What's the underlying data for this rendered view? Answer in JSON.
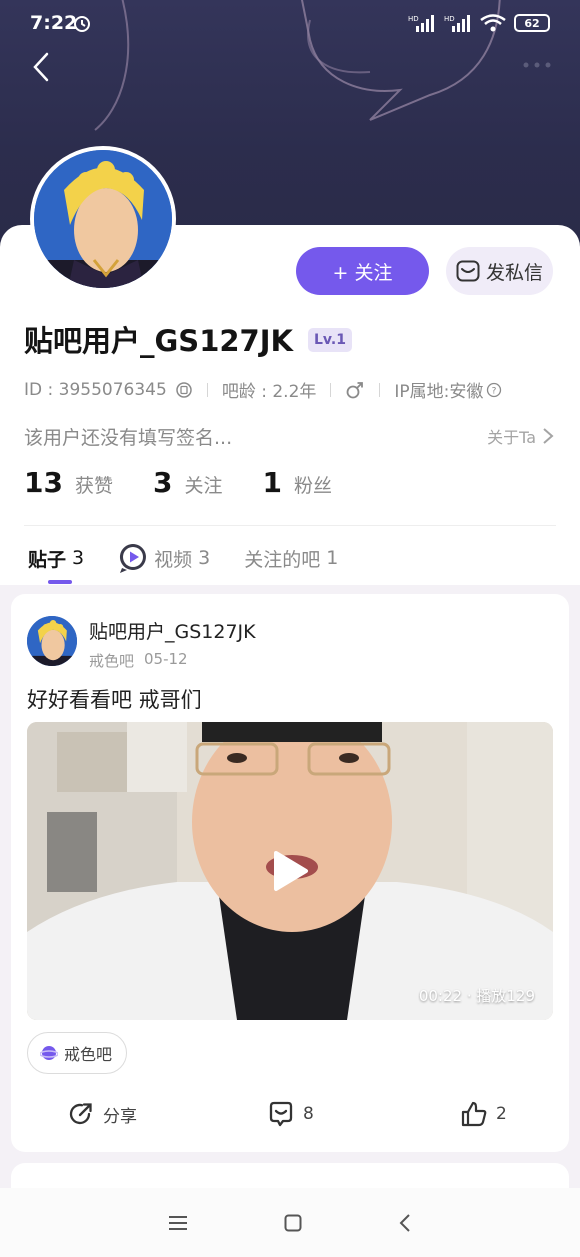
{
  "status_bar": {
    "time": "7:22",
    "signal1": "HD",
    "signal2": "HD",
    "battery": "62"
  },
  "profile": {
    "username": "贴吧用户_GS127JK",
    "level": "Lv.1",
    "id_text": "ID : 3955076345",
    "bar_age": "吧龄 : 2.2年",
    "ip": "IP属地:安徽",
    "signature": "该用户还没有填写签名...",
    "about_label": "关于Ta",
    "follow_button": "+ 关注",
    "message_button": "发私信",
    "stats": [
      {
        "num": "13",
        "label": "获赞"
      },
      {
        "num": "3",
        "label": "关注"
      },
      {
        "num": "1",
        "label": "粉丝"
      }
    ]
  },
  "tabs": [
    {
      "label": "贴子",
      "count": "3"
    },
    {
      "label": "视频",
      "count": "3"
    },
    {
      "label": "关注的吧",
      "count": "1"
    }
  ],
  "post": {
    "author": "贴吧用户_GS127JK",
    "forum": "戒色吧",
    "date": "05-12",
    "text": "好好看看吧 戒哥们",
    "video_info": "00:22 · 播放129",
    "forum_chip": "戒色吧",
    "share_label": "分享",
    "comment_count": "8",
    "like_count": "2"
  },
  "colors": {
    "accent": "#7559ec",
    "banner": "#2c2d4d"
  }
}
